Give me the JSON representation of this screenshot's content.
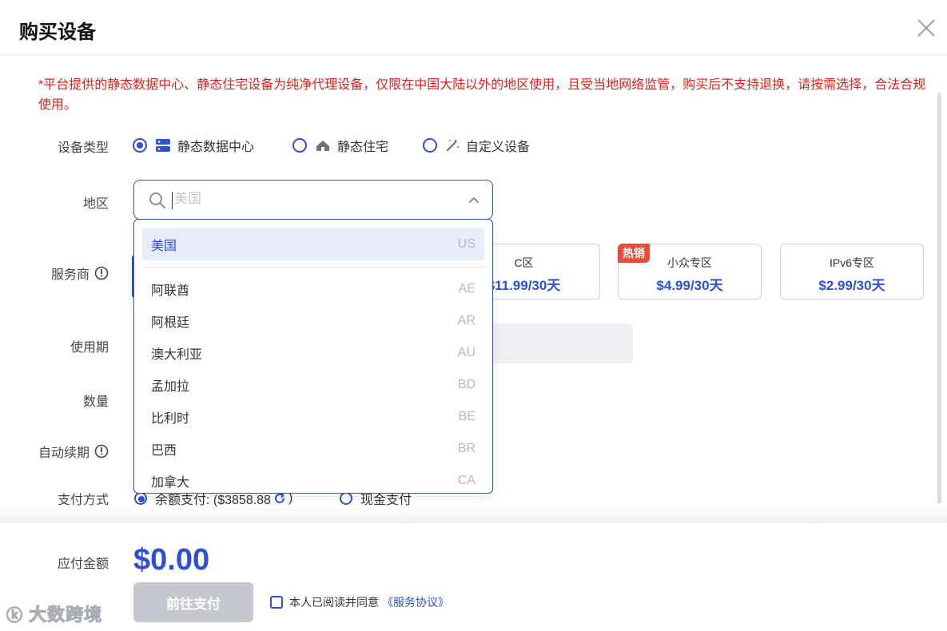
{
  "header": {
    "title": "购买设备"
  },
  "notice": "*平台提供的静态数据中心、静态住宅设备为纯净代理设备，仅限在中国大陆以外的地区使用，且受当地网络监管，购买后不支持退换，请按需选择，合法合规使用。",
  "labels": {
    "device_type": "设备类型",
    "region": "地区",
    "provider": "服务商",
    "period": "使用期",
    "quantity": "数量",
    "auto_renew": "自动续期",
    "payment_method": "支付方式",
    "amount_due": "应付金额"
  },
  "device_types": [
    {
      "label": "静态数据中心",
      "selected": true,
      "icon": "server-icon"
    },
    {
      "label": "静态住宅",
      "selected": false,
      "icon": "home-icon"
    },
    {
      "label": "自定义设备",
      "selected": false,
      "icon": "magic-wand-icon"
    }
  ],
  "region_search": {
    "placeholder": "美国",
    "value": ""
  },
  "region_options": [
    {
      "name": "美国",
      "code": "US",
      "selected": true
    },
    {
      "name": "阿联酋",
      "code": "AE"
    },
    {
      "name": "阿根廷",
      "code": "AR"
    },
    {
      "name": "澳大利亚",
      "code": "AU"
    },
    {
      "name": "孟加拉",
      "code": "BD"
    },
    {
      "name": "比利时",
      "code": "BE"
    },
    {
      "name": "巴西",
      "code": "BR"
    },
    {
      "name": "加拿大",
      "code": "CA"
    }
  ],
  "plans": [
    {
      "name": "C区",
      "price": "$11.99/30天"
    },
    {
      "name": "小众专区",
      "price": "$4.99/30天",
      "badge": "热销"
    },
    {
      "name": "IPv6专区",
      "price": "$2.99/30天"
    }
  ],
  "payment": {
    "balance_label": "余额支付: ($3858.88",
    "balance_suffix": ")",
    "cash_label": "现金支付"
  },
  "total": "$0.00",
  "pay_button": "前往支付",
  "agreement": {
    "text": "本人已阅读并同意",
    "link": "《服务协议》"
  },
  "watermark": "大数跨境",
  "colors": {
    "accent": "#2f4fd8",
    "warning": "#e0201b",
    "hot_badge": "#e84a3c"
  }
}
